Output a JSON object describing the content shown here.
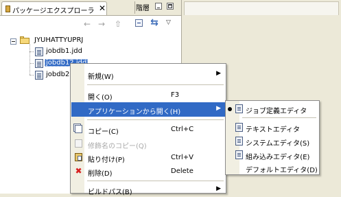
{
  "view": {
    "tab_title": "パッケージエクスプローラ",
    "tab_close": "✕",
    "inactive_tab": "階層",
    "toolbar": {
      "back_icon": "←",
      "forward_icon": "→",
      "up_icon": "⇧",
      "link_icon": "⇆",
      "view_menu_icon": "▽"
    }
  },
  "tree": {
    "project": "JYUHATTYUPRJ",
    "files": [
      {
        "label": "jobdb1.jdd",
        "selected": false
      },
      {
        "label": "jobdb12.jdd",
        "selected": true
      },
      {
        "label": "jobdb2.",
        "selected": false
      }
    ]
  },
  "context_menu": {
    "items": [
      {
        "label": "新規(W)",
        "arrow": "▶"
      },
      {
        "label": "開く(O)",
        "shortcut": "F3"
      },
      {
        "label": "アプリケーションから開く(H)",
        "arrow": "▶"
      },
      {
        "label": "コピー(C)",
        "shortcut": "Ctrl+C"
      },
      {
        "label": "修飾名のコピー(Q)"
      },
      {
        "label": "貼り付け(P)",
        "shortcut": "Ctrl+V"
      },
      {
        "label": "削除(D)",
        "shortcut": "Delete"
      },
      {
        "label": "ビルドパス(B)",
        "arrow": "▶"
      }
    ]
  },
  "submenu": {
    "items": [
      {
        "label": "ジョブ定義エディタ",
        "checked": true
      },
      {
        "label": "テキストエディタ"
      },
      {
        "label": "システムエディタ(S)"
      },
      {
        "label": "組み込みエディタ(E)"
      },
      {
        "label": "デフォルトエディタ(D)"
      }
    ]
  },
  "colors": {
    "selection": "#316ac5",
    "menu_gutter": "#f1efe2",
    "chrome": "#ece9d8"
  }
}
